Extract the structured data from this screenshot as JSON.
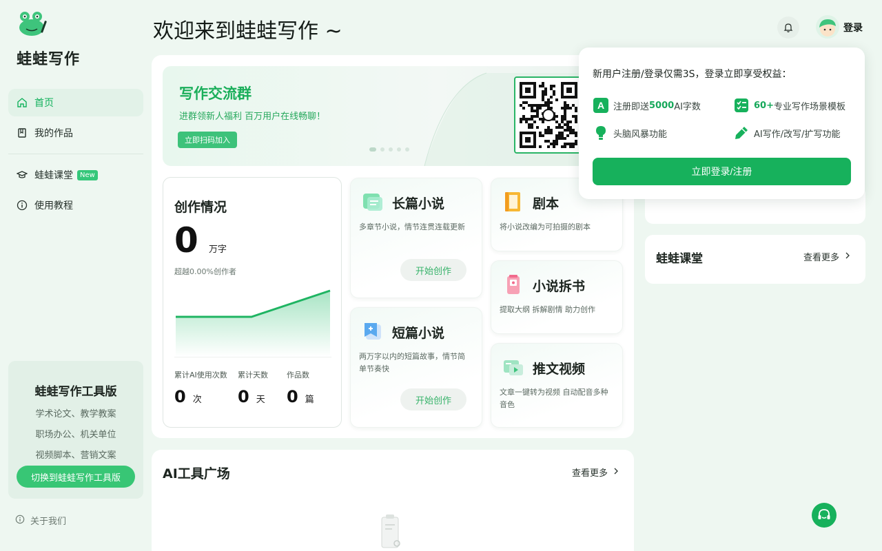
{
  "sidebar": {
    "brand": "蛙蛙写作",
    "nav": [
      {
        "label": "首页",
        "icon": "home-icon"
      },
      {
        "label": "我的作品",
        "icon": "book-icon"
      },
      {
        "label": "蛙蛙课堂",
        "icon": "graduation-cap-icon",
        "badge": "New"
      },
      {
        "label": "使用教程",
        "icon": "info-icon"
      }
    ],
    "tool_card": {
      "title": "蛙蛙写作工具版",
      "lines": [
        "学术论文、教学教案",
        "职场办公、机关单位",
        "视频脚本、营销文案"
      ],
      "button": "切换到蛙蛙写作工具版"
    },
    "about": "关于我们"
  },
  "header": {
    "title": "欢迎来到蛙蛙写作 ~",
    "login": "登录"
  },
  "banner": {
    "title": "写作交流群",
    "subtitle": "进群领新人福利 百万用户在线畅聊！",
    "button": "立即扫码加入"
  },
  "stats": {
    "title": "创作情况",
    "big_value": "0",
    "big_unit": "万字",
    "sub": "超越0.00%创作者",
    "metrics": [
      {
        "label": "累计AI使用次数",
        "value": "0",
        "unit": "次"
      },
      {
        "label": "累计天数",
        "value": "0",
        "unit": "天"
      },
      {
        "label": "作品数",
        "value": "0",
        "unit": "篇"
      }
    ]
  },
  "features": {
    "novel": {
      "title": "长篇小说",
      "desc": "多章节小说，情节连贯连载更新",
      "button": "开始创作"
    },
    "short": {
      "title": "短篇小说",
      "desc": "两万字以内的短篇故事，情节简单节奏快",
      "button": "开始创作"
    },
    "script": {
      "title": "剧本",
      "desc": "将小说改编为可拍摄的剧本"
    },
    "split": {
      "title": "小说拆书",
      "desc": "提取大纲 拆解剧情 助力创作"
    },
    "video": {
      "title": "推文视频",
      "desc": "文章一键转为视频 自动配音多种音色"
    }
  },
  "ai_tools": {
    "title": "AI工具广场",
    "more": "查看更多"
  },
  "right": {
    "course_title": "蛙蛙课堂",
    "course_more": "查看更多"
  },
  "popup": {
    "headline": "新用户注册/登录仅需3S，登录立即享受权益：",
    "perks": [
      {
        "pre": "注册即送",
        "bold": "5000",
        "post": "AI字数",
        "icon": "letter-a-icon"
      },
      {
        "pre": "",
        "bold": "60+",
        "post": "专业写作场景模板",
        "icon": "checklist-icon"
      },
      {
        "pre": "头脑风暴功能",
        "bold": "",
        "post": "",
        "icon": "lightbulb-icon"
      },
      {
        "pre": "AI写作/改写/扩写功能",
        "bold": "",
        "post": "",
        "icon": "pen-icon"
      }
    ],
    "button": "立即登录/注册"
  },
  "colors": {
    "accent": "#17b15c",
    "bg": "#eef7f1"
  }
}
